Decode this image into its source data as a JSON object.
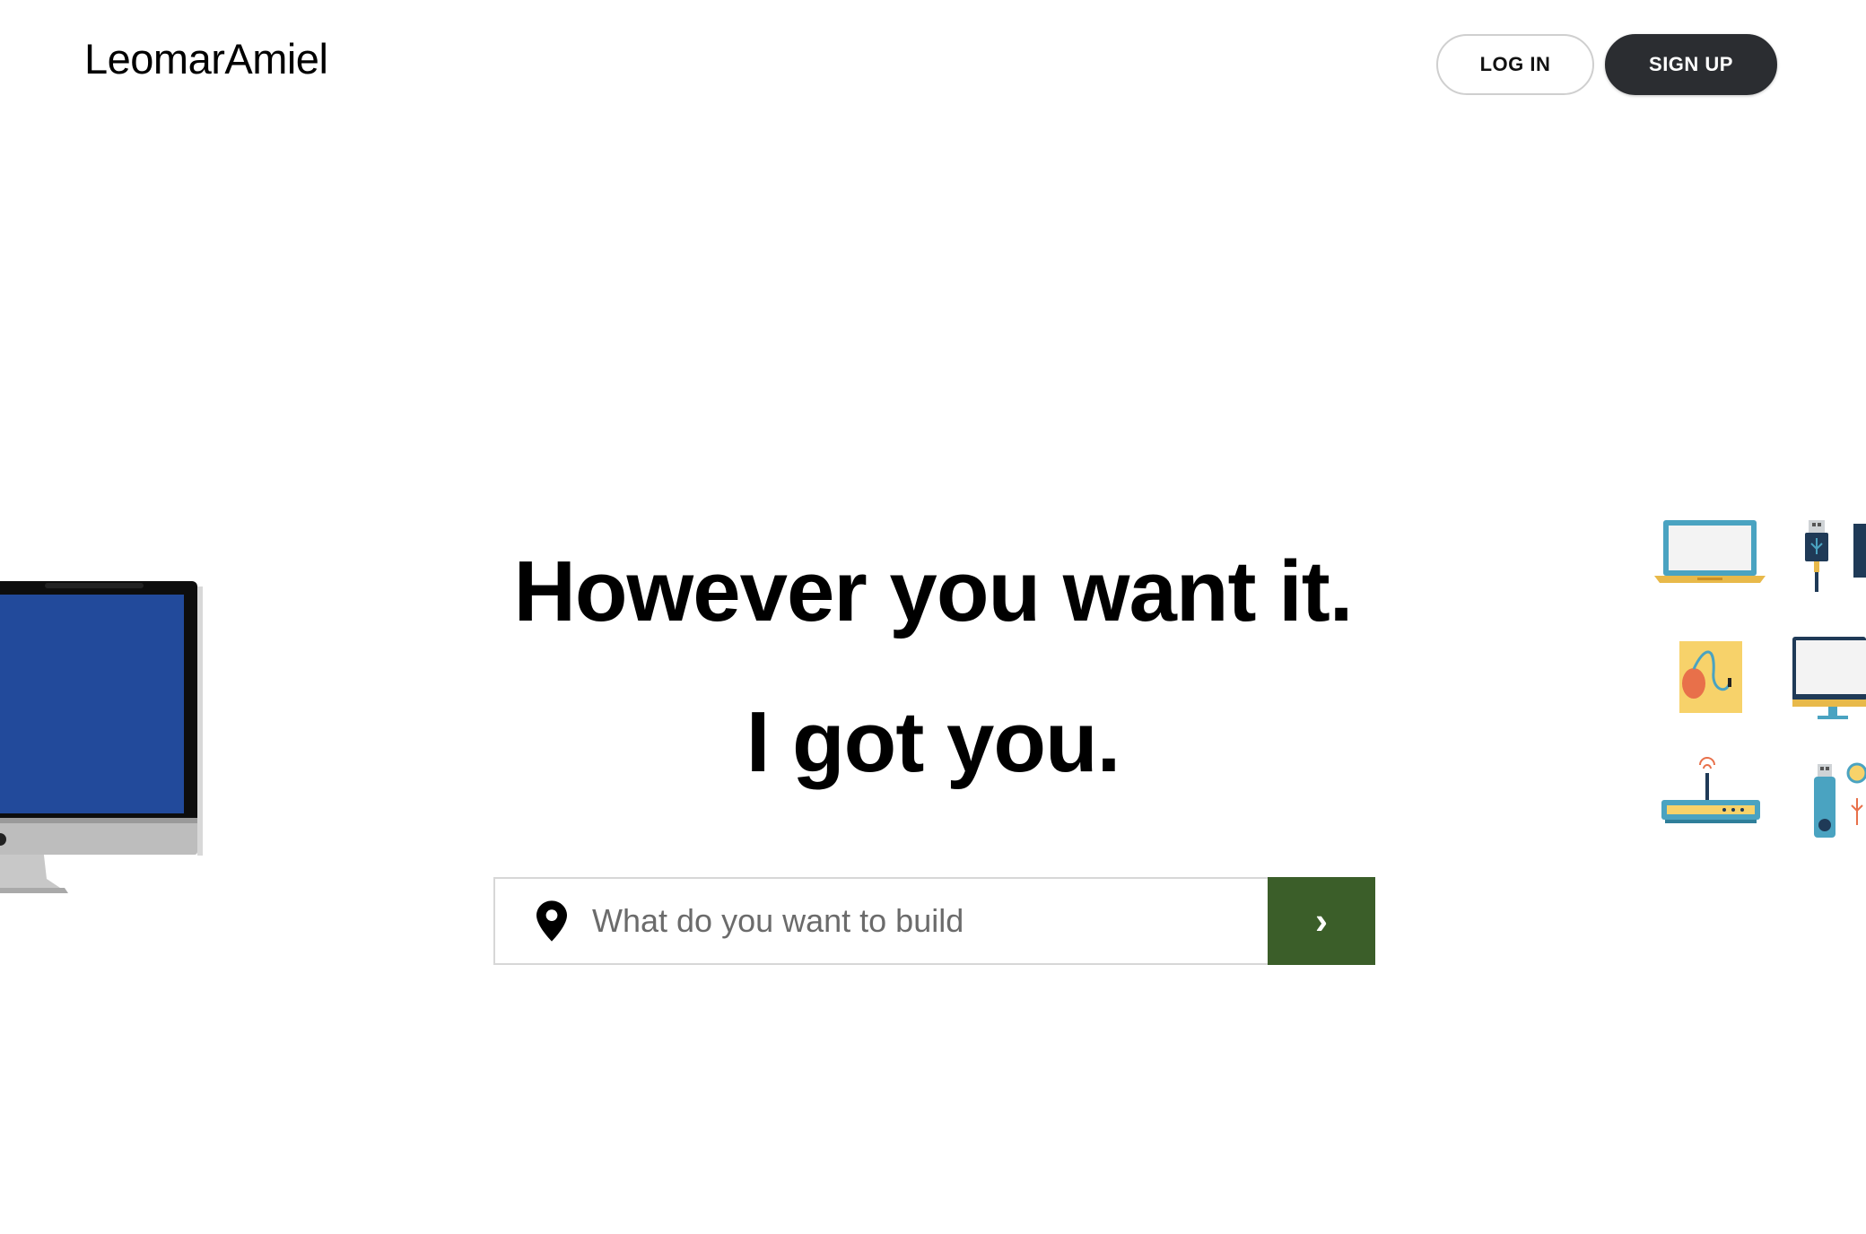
{
  "header": {
    "brand": "LeomarAmiel",
    "login_label": "LOG IN",
    "signup_label": "SIGN UP"
  },
  "hero": {
    "headline_line1": "However you want it.",
    "headline_line2": "I got you."
  },
  "search": {
    "placeholder": "What do you want to build",
    "value": "",
    "submit_glyph": "›",
    "icon": "map-pin-icon"
  },
  "colors": {
    "signup_bg": "#2b2d31",
    "submit_bg": "#3b5e29",
    "imac_screen": "#224a9b"
  },
  "illustrations": {
    "left": "imac-icon",
    "right": [
      "laptop-icon",
      "usb-cable-icon",
      "mouse-icon",
      "monitor-icon",
      "router-icon",
      "usb-drive-icon"
    ]
  }
}
